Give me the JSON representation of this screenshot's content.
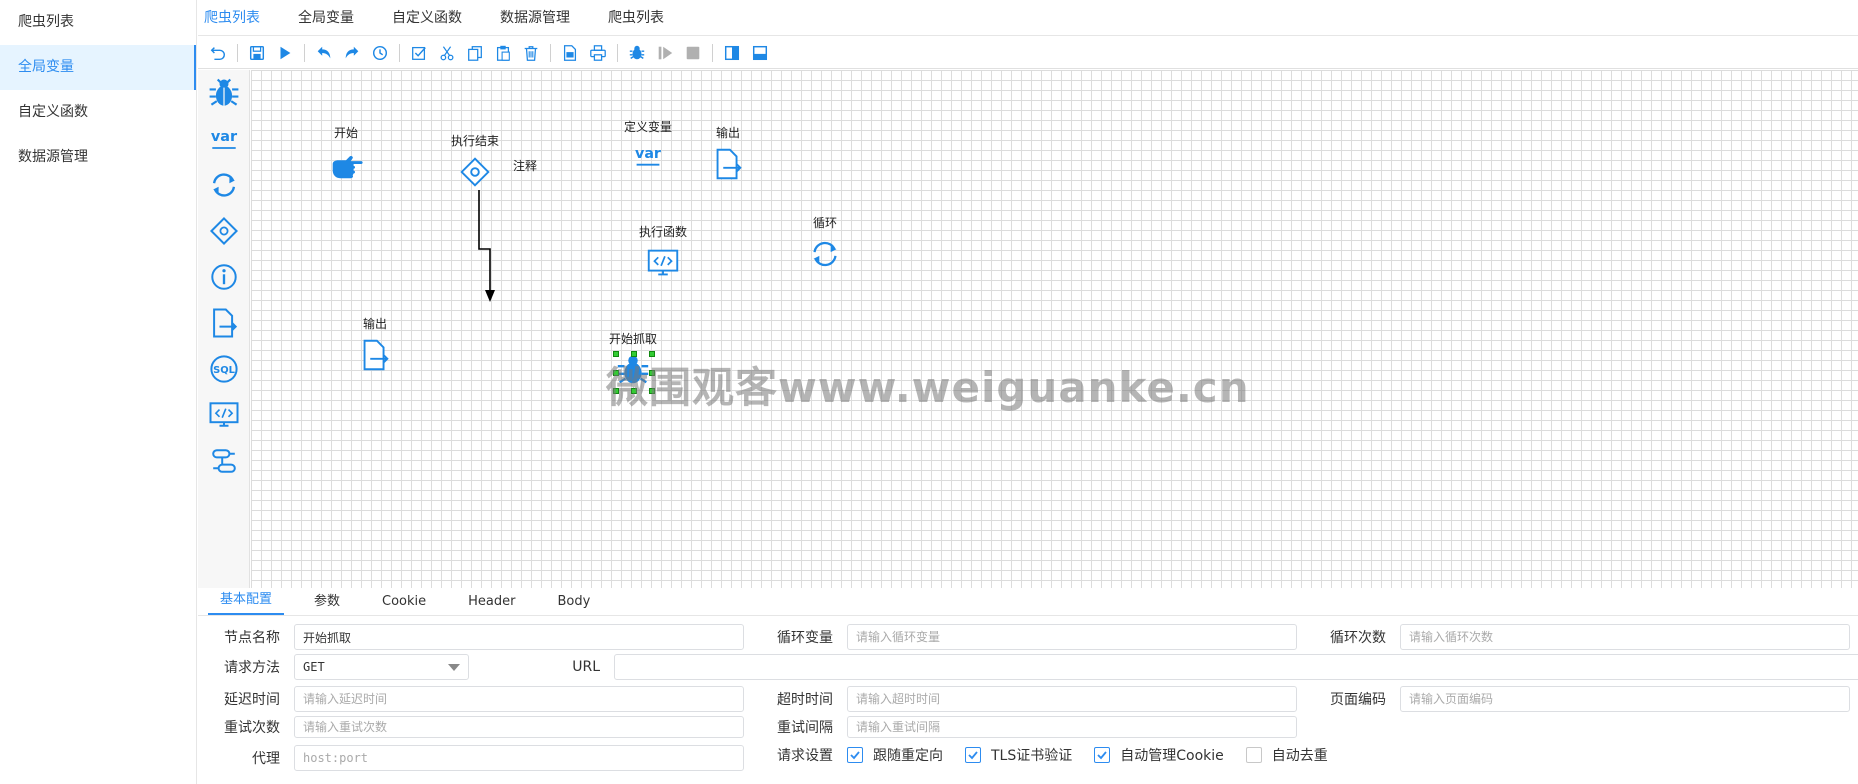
{
  "sidebar": {
    "items": [
      {
        "label": "爬虫列表"
      },
      {
        "label": "全局变量"
      },
      {
        "label": "自定义函数"
      },
      {
        "label": "数据源管理"
      }
    ]
  },
  "tabs": [
    {
      "label": "爬虫列表"
    },
    {
      "label": "全局变量"
    },
    {
      "label": "自定义函数"
    },
    {
      "label": "数据源管理"
    },
    {
      "label": "爬虫列表"
    }
  ],
  "canvas": {
    "nodes": {
      "start": "开始",
      "end": "执行结束",
      "note": "注释",
      "define_var": "定义变量",
      "output1": "输出",
      "exec_func": "执行函数",
      "loop": "循环",
      "output2": "输出",
      "crawl": "开始抓取"
    },
    "var_text": "var",
    "watermark": "微围观客www.weiguanke.cn"
  },
  "palette": {
    "var_text": "var",
    "sql_text": "SQL"
  },
  "bottom": {
    "tabs": [
      {
        "label": "基本配置"
      },
      {
        "label": "参数"
      },
      {
        "label": "Cookie"
      },
      {
        "label": "Header"
      },
      {
        "label": "Body"
      }
    ],
    "form": {
      "node_name": {
        "label": "节点名称",
        "value": "开始抓取"
      },
      "loop_var": {
        "label": "循环变量",
        "placeholder": "请输入循环变量"
      },
      "loop_count": {
        "label": "循环次数",
        "placeholder": "请输入循环次数"
      },
      "method": {
        "label": "请求方法",
        "value": "GET"
      },
      "url": {
        "label": "URL",
        "value": ""
      },
      "delay": {
        "label": "延迟时间",
        "placeholder": "请输入延迟时间"
      },
      "timeout": {
        "label": "超时时间",
        "placeholder": "请输入超时时间"
      },
      "encoding": {
        "label": "页面编码",
        "placeholder": "请输入页面编码"
      },
      "retry_count": {
        "label": "重试次数",
        "placeholder": "请输入重试次数"
      },
      "retry_interval": {
        "label": "重试间隔",
        "placeholder": "请输入重试间隔"
      },
      "proxy": {
        "label": "代理",
        "placeholder": "host:port"
      },
      "request_settings": {
        "label": "请求设置",
        "options": [
          {
            "label": "跟随重定向",
            "checked": true
          },
          {
            "label": "TLS证书验证",
            "checked": true
          },
          {
            "label": "自动管理Cookie",
            "checked": true
          },
          {
            "label": "自动去重",
            "checked": false
          }
        ]
      }
    }
  },
  "colors": {
    "accent": "#2d8cf0",
    "icon": "#1e88e5",
    "selection": "#33cc33"
  }
}
